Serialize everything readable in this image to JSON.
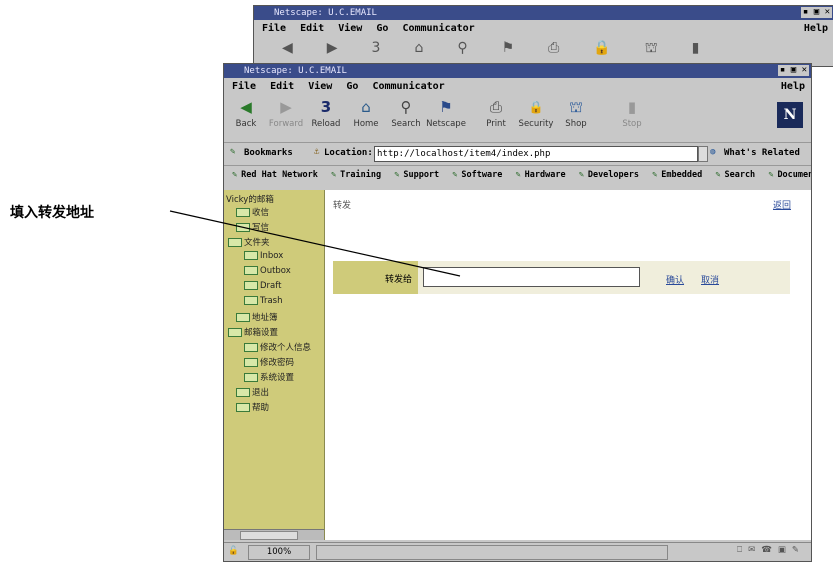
{
  "back_window": {
    "title": "Netscape: U.C.EMAIL",
    "menu": [
      "File",
      "Edit",
      "View",
      "Go",
      "Communicator"
    ],
    "help": "Help"
  },
  "window": {
    "title": "Netscape: U.C.EMAIL",
    "menu": [
      "File",
      "Edit",
      "View",
      "Go",
      "Communicator"
    ],
    "help": "Help",
    "toolbar": [
      {
        "label": "Back",
        "icon": "back-arrow-icon",
        "glyph": "◀"
      },
      {
        "label": "Forward",
        "icon": "forward-arrow-icon",
        "glyph": "▶"
      },
      {
        "label": "Reload",
        "icon": "reload-icon",
        "glyph": "3"
      },
      {
        "label": "Home",
        "icon": "home-icon",
        "glyph": "⌂"
      },
      {
        "label": "Search",
        "icon": "search-icon",
        "glyph": "⚲"
      },
      {
        "label": "Netscape",
        "icon": "netscape-icon",
        "glyph": "⚑"
      },
      {
        "label": "Print",
        "icon": "print-icon",
        "glyph": "⎙"
      },
      {
        "label": "Security",
        "icon": "security-lock-icon",
        "glyph": "🔒"
      },
      {
        "label": "Shop",
        "icon": "shop-icon",
        "glyph": "⛫"
      },
      {
        "label": "Stop",
        "icon": "stop-icon",
        "glyph": "▮"
      }
    ],
    "bookmarks_label": "Bookmarks",
    "location_label": "Location:",
    "url": "http://localhost/item4/index.php",
    "whats_related": "What's Related",
    "personal_toolbar": [
      "Red Hat Network",
      "Training",
      "Support",
      "Software",
      "Hardware",
      "Developers",
      "Embedded",
      "Search",
      "Documen"
    ],
    "zoom": "100%"
  },
  "sidebar": {
    "account": "Vicky的邮箱",
    "items": [
      {
        "label": "收信",
        "level": 1
      },
      {
        "label": "写信",
        "level": 1
      },
      {
        "label": "文件夹",
        "level": 0
      },
      {
        "label": "Inbox",
        "level": 2
      },
      {
        "label": "Outbox",
        "level": 2
      },
      {
        "label": "Draft",
        "level": 2
      },
      {
        "label": "Trash",
        "level": 2
      },
      {
        "label": "地址簿",
        "level": 1
      },
      {
        "label": "邮箱设置",
        "level": 0
      },
      {
        "label": "修改个人信息",
        "level": 2
      },
      {
        "label": "修改密码",
        "level": 2
      },
      {
        "label": "系统设置",
        "level": 2
      },
      {
        "label": "退出",
        "level": 1
      },
      {
        "label": "帮助",
        "level": 1
      }
    ]
  },
  "main": {
    "heading": "转发",
    "back_link": "返回",
    "field_label": "转发给",
    "field_value": "",
    "confirm": "确认",
    "cancel": "取消"
  },
  "annotation": "填入转发地址"
}
